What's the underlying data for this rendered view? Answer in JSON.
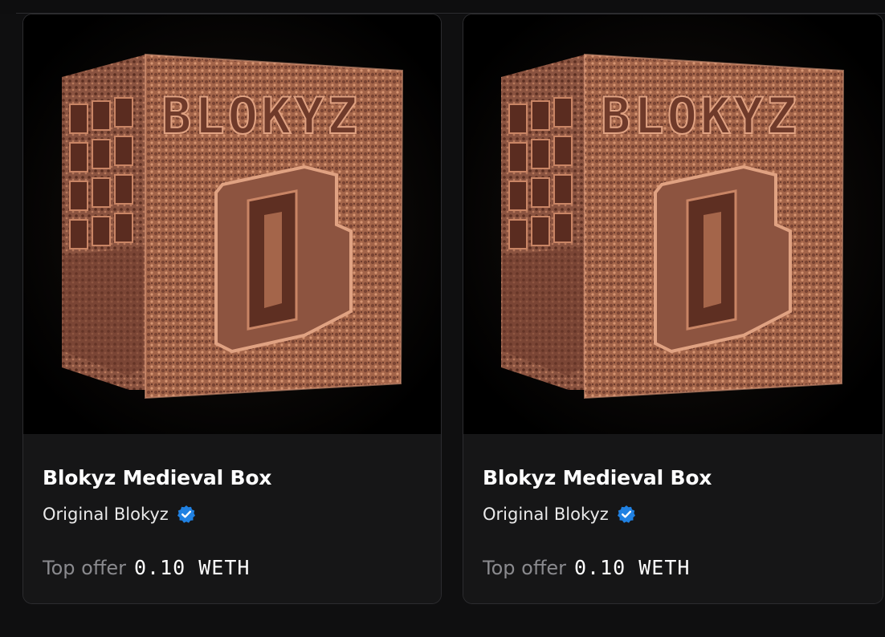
{
  "cards": [
    {
      "image_label": "BLOKYZ",
      "title": "Blokyz Medieval Box",
      "collection": "Original Blokyz",
      "verified_icon": "verified-badge-icon",
      "offer_label": "Top offer",
      "offer_value": "0.10 WETH"
    },
    {
      "image_label": "BLOKYZ",
      "title": "Blokyz Medieval Box",
      "collection": "Original Blokyz",
      "verified_icon": "verified-badge-icon",
      "offer_label": "Top offer",
      "offer_value": "0.10 WETH"
    }
  ],
  "colors": {
    "background": "#0f0f10",
    "card": "#161617",
    "verified": "#2081e2",
    "box_copper": "#b0704e"
  }
}
